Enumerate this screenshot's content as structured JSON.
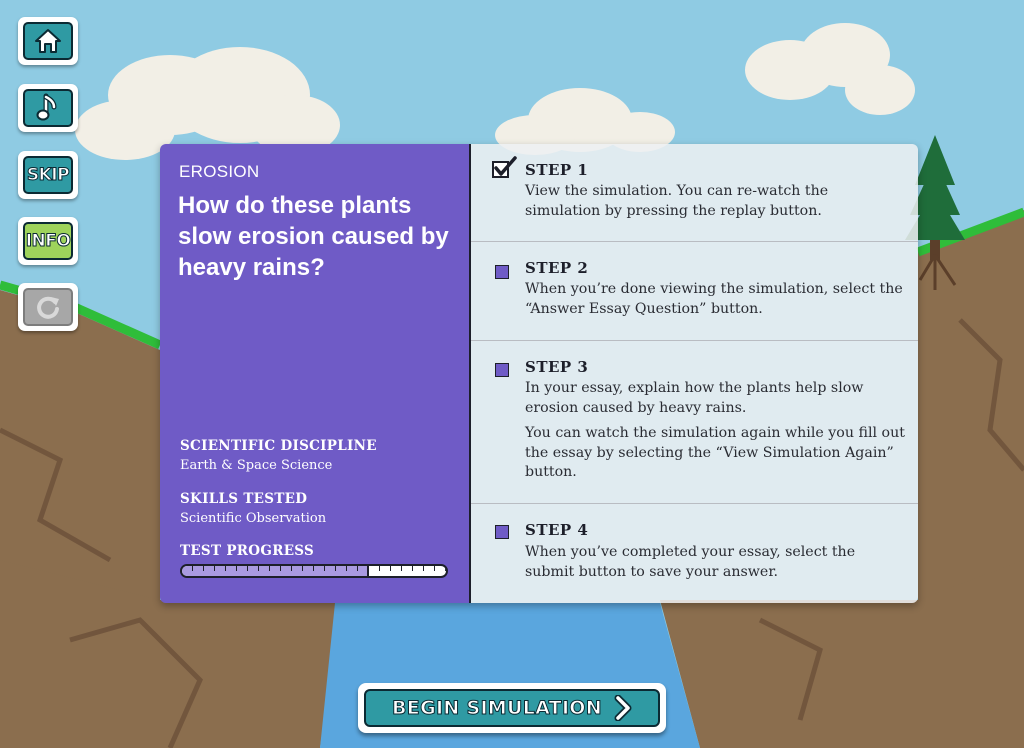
{
  "sidebar": {
    "home_icon": "home-icon",
    "music_icon": "music-note-icon",
    "skip_label": "SKIP",
    "info_label": "INFO",
    "replay_icon": "replay-icon"
  },
  "panel": {
    "topic": "EROSION",
    "question": "How do these plants slow erosion caused by heavy rains?",
    "discipline_heading": "SCIENTIFIC DISCIPLINE",
    "discipline_value": "Earth & Space Science",
    "skills_heading": "SKILLS TESTED",
    "skills_value": "Scientific Observation",
    "progress_heading": "TEST PROGRESS",
    "progress_fraction": 0.7
  },
  "steps": [
    {
      "title": "STEP 1",
      "completed": true,
      "text": "View the simulation. You can re-watch the simulation by pressing the replay button.",
      "text2": ""
    },
    {
      "title": "STEP 2",
      "completed": false,
      "text": "When you’re done viewing the simulation, select the “Answer Essay Question” button.",
      "text2": ""
    },
    {
      "title": "STEP 3",
      "completed": false,
      "text": "In your essay, explain how the plants help slow erosion caused by heavy rains.",
      "text2": "You can watch the simulation again while you fill out the essay by selecting the “View Simulation Again” button."
    },
    {
      "title": "STEP 4",
      "completed": false,
      "text": "When you’ve completed your essay, select the submit button to save your answer.",
      "text2": ""
    }
  ],
  "begin_button": {
    "label": "BEGIN SIMULATION",
    "icon": "chevron-right-icon"
  },
  "colors": {
    "sky": "#8fcbe3",
    "ground": "#8b6e4e",
    "grass": "#2fbd3a",
    "water": "#5aa6de",
    "panel_purple": "#6f5bc6",
    "button_teal": "#2f9aa3",
    "info_green": "#9ed35b"
  }
}
